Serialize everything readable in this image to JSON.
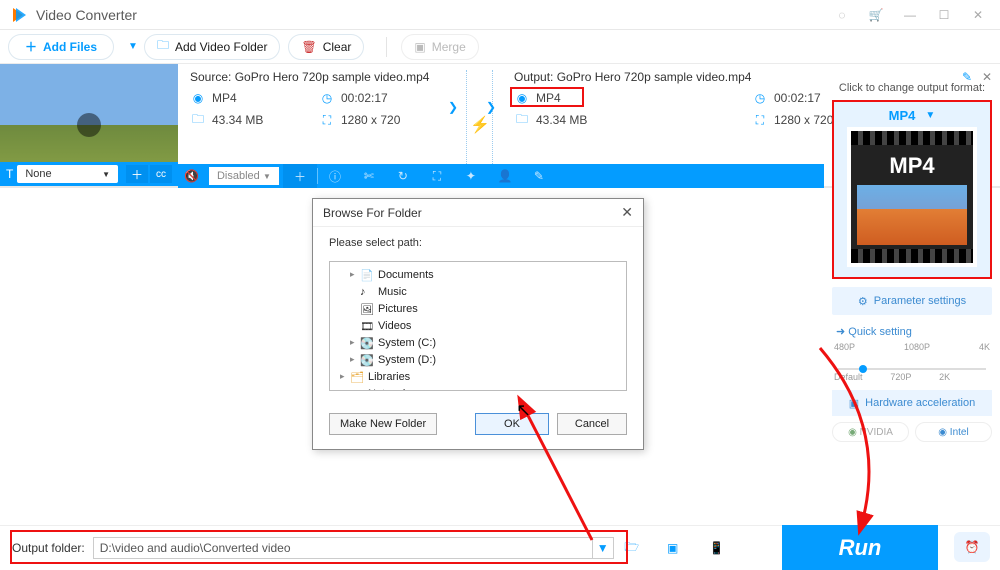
{
  "app": {
    "title": "Video Converter"
  },
  "toolbar": {
    "add_files": "Add Files",
    "add_folder": "Add Video Folder",
    "clear": "Clear",
    "merge": "Merge"
  },
  "source": {
    "label": "Source: GoPro Hero 720p sample video.mp4",
    "format": "MP4",
    "duration": "00:02:17",
    "size": "43.34 MB",
    "resolution": "1280 x 720"
  },
  "output": {
    "label": "Output: GoPro Hero 720p sample video.mp4",
    "format": "MP4",
    "duration": "00:02:17",
    "size": "43.34 MB",
    "resolution": "1280 x 720"
  },
  "editbar": {
    "text_dropdown": "None",
    "audio_dropdown": "Disabled"
  },
  "right": {
    "label": "Click to change output format:",
    "format": "MP4",
    "param_btn": "Parameter settings",
    "quick_label": "Quick setting",
    "ticks_top": [
      "480P",
      "1080P",
      "4K"
    ],
    "ticks_bot": [
      "Default",
      "720P",
      "2K",
      ""
    ],
    "hw": "Hardware acceleration",
    "nvidia": "NVIDIA",
    "intel": "Intel"
  },
  "dialog": {
    "title": "Browse For Folder",
    "msg": "Please select path:",
    "items": [
      "Documents",
      "Music",
      "Pictures",
      "Videos",
      "System (C:)",
      "System (D:)",
      "Libraries",
      "Network"
    ],
    "new_folder": "Make New Folder",
    "ok": "OK",
    "cancel": "Cancel"
  },
  "bottom": {
    "label": "Output folder:",
    "path": "D:\\video and audio\\Converted video",
    "run": "Run"
  }
}
